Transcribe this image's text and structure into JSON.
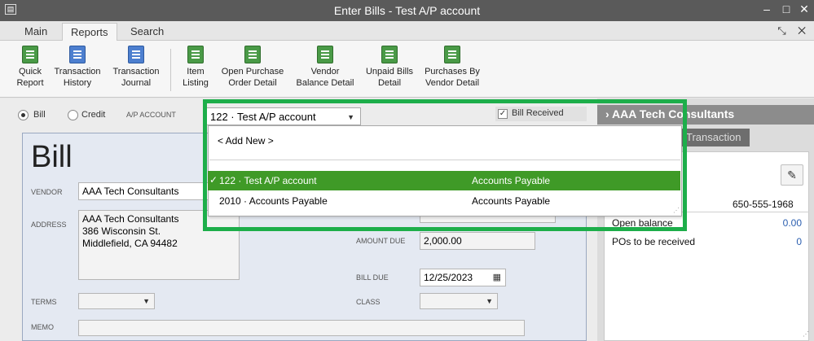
{
  "window": {
    "title": "Enter Bills - Test A/P account",
    "sys_icon": "▤"
  },
  "tabs": [
    {
      "label": "Main"
    },
    {
      "label": "Reports"
    },
    {
      "label": "Search"
    }
  ],
  "ribbon": [
    {
      "label1": "Quick",
      "label2": "Report",
      "icon": "magnifier-report-icon"
    },
    {
      "label1": "Transaction",
      "label2": "History",
      "icon": "history-icon"
    },
    {
      "label1": "Transaction",
      "label2": "Journal",
      "icon": "journal-icon"
    },
    {
      "label1": "Item",
      "label2": "Listing",
      "icon": "report-icon"
    },
    {
      "label1": "Open Purchase",
      "label2": "Order Detail",
      "icon": "report-icon"
    },
    {
      "label1": "Vendor",
      "label2": "Balance Detail",
      "icon": "report-icon"
    },
    {
      "label1": "Unpaid Bills",
      "label2": "Detail",
      "icon": "report-icon"
    },
    {
      "label1": "Purchases By",
      "label2": "Vendor Detail",
      "icon": "report-icon"
    }
  ],
  "form": {
    "bill_radio": "Bill",
    "credit_radio": "Credit",
    "ap_account_label": "A/P ACCOUNT",
    "ap_account_value": "122 · Test A/P account",
    "bill_received_label": "Bill Received",
    "bill_received_checked": true,
    "title": "Bill",
    "vendor_label": "VENDOR",
    "vendor_value": "AAA Tech Consultants",
    "address_label": "ADDRESS",
    "address_lines": [
      "AAA Tech Consultants",
      "386 Wisconsin St.",
      "Middlefield, CA 94482"
    ],
    "amount_due_label": "AMOUNT DUE",
    "amount_due_value": "2,000.00",
    "bill_due_label": "BILL DUE",
    "bill_due_value": "12/25/2023",
    "terms_label": "TERMS",
    "class_label": "CLASS",
    "memo_label": "MEMO"
  },
  "dropdown": {
    "add_new": "< Add New >",
    "rows": [
      {
        "name": "122 · Test A/P account",
        "type": "Accounts Payable",
        "selected": true
      },
      {
        "name": "2010 · Accounts Payable",
        "type": "Accounts Payable",
        "selected": false
      }
    ]
  },
  "right_panel": {
    "title": "AAA Tech Consultants",
    "tab": "Transaction",
    "phone": "650-555-1968",
    "open_balance_label": "Open balance",
    "open_balance_value": "0.00",
    "pos_label": "POs to be received",
    "pos_value": "0"
  },
  "colors": {
    "highlight": "#1dae4a",
    "selection": "#3f9a27",
    "titlebar": "#5a5a5a"
  }
}
